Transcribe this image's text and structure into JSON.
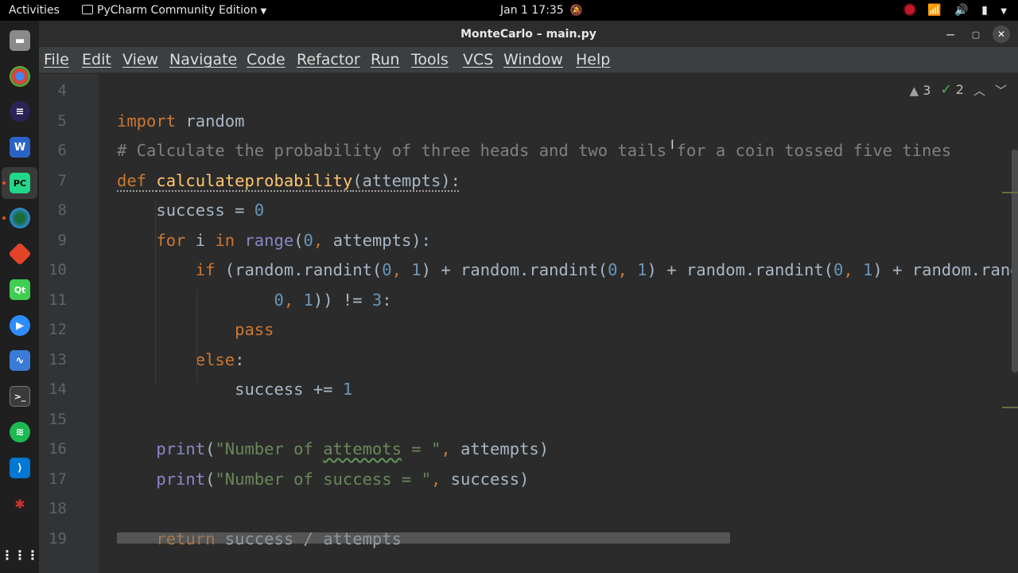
{
  "topbar": {
    "activities": "Activities",
    "app_menu": "PyCharm Community Edition",
    "clock": "Jan 1  17:35"
  },
  "window": {
    "title": "MonteCarlo – main.py"
  },
  "menu": [
    "File",
    "Edit",
    "View",
    "Navigate",
    "Code",
    "Refactor",
    "Run",
    "Tools",
    "VCS",
    "Window",
    "Help"
  ],
  "inspections": {
    "warnings": "3",
    "weak_warnings": "2"
  },
  "dock": {
    "icons": [
      "files-icon",
      "chrome-icon",
      "eclipse-icon",
      "writer-icon",
      "pycharm-icon",
      "browser-icon",
      "git-icon",
      "qt-icon",
      "zoom-icon",
      "monitor-icon",
      "terminal-icon",
      "spotify-icon",
      "vscode-icon",
      "bug-icon",
      "apps-grid-icon"
    ]
  },
  "editor": {
    "line_numbers": [
      "4",
      "5",
      "6",
      "7",
      "8",
      "9",
      "10",
      "11",
      "12",
      "13",
      "14",
      "15",
      "16",
      "17",
      "18",
      "19"
    ],
    "lines": [
      [],
      [
        [
          "kw",
          "import"
        ],
        [
          "",
          " random"
        ]
      ],
      [
        [
          "cmt",
          "# Calculate the probability of three heads and two tails for a coin tossed five tines"
        ]
      ],
      [
        [
          "kw warnu",
          "def "
        ],
        [
          "fn warnu",
          "calculateprobability"
        ],
        [
          "warnu",
          "(attempts):"
        ]
      ],
      [
        [
          "",
          "    success = "
        ],
        [
          "num",
          "0"
        ]
      ],
      [
        [
          "",
          "    "
        ],
        [
          "kw",
          "for"
        ],
        [
          "",
          " i "
        ],
        [
          "kw",
          "in"
        ],
        [
          "",
          " "
        ],
        [
          "blt",
          "range"
        ],
        [
          "",
          "("
        ],
        [
          "num",
          "0"
        ],
        [
          "kw",
          ", "
        ],
        [
          "",
          "attempts):"
        ]
      ],
      [
        [
          "",
          "        "
        ],
        [
          "kw",
          "if"
        ],
        [
          "",
          " (random.randint("
        ],
        [
          "num",
          "0"
        ],
        [
          "kw",
          ", "
        ],
        [
          "num",
          "1"
        ],
        [
          "",
          ") + random.randint("
        ],
        [
          "num",
          "0"
        ],
        [
          "kw",
          ", "
        ],
        [
          "num",
          "1"
        ],
        [
          "",
          ") + random.randint("
        ],
        [
          "num",
          "0"
        ],
        [
          "kw",
          ", "
        ],
        [
          "num",
          "1"
        ],
        [
          "",
          ") + random.randint("
        ],
        [
          "num",
          "0"
        ],
        [
          "kw",
          ", "
        ],
        [
          "num",
          "1"
        ],
        [
          "",
          ")"
        ]
      ],
      [
        [
          "",
          "                "
        ],
        [
          "num",
          "0"
        ],
        [
          "kw",
          ", "
        ],
        [
          "num",
          "1"
        ],
        [
          "",
          ")) != "
        ],
        [
          "num",
          "3"
        ],
        [
          "",
          ":"
        ]
      ],
      [
        [
          "",
          "            "
        ],
        [
          "kw",
          "pass"
        ]
      ],
      [
        [
          "",
          "        "
        ],
        [
          "kw",
          "else"
        ],
        [
          "",
          ":"
        ]
      ],
      [
        [
          "",
          "            success += "
        ],
        [
          "num",
          "1"
        ]
      ],
      [],
      [
        [
          "",
          "    "
        ],
        [
          "blt",
          "print"
        ],
        [
          "",
          "("
        ],
        [
          "str",
          "\"Number of "
        ],
        [
          "str typo",
          "attemots"
        ],
        [
          "str",
          " = \""
        ],
        [
          "kw",
          ", "
        ],
        [
          "",
          "attempts)"
        ]
      ],
      [
        [
          "",
          "    "
        ],
        [
          "blt",
          "print"
        ],
        [
          "",
          "("
        ],
        [
          "str",
          "\"Number of success = \""
        ],
        [
          "kw",
          ", "
        ],
        [
          "",
          "success)"
        ]
      ],
      [],
      [
        [
          "",
          "    "
        ],
        [
          "kw",
          "return"
        ],
        [
          "",
          " success / attempts"
        ]
      ]
    ]
  }
}
